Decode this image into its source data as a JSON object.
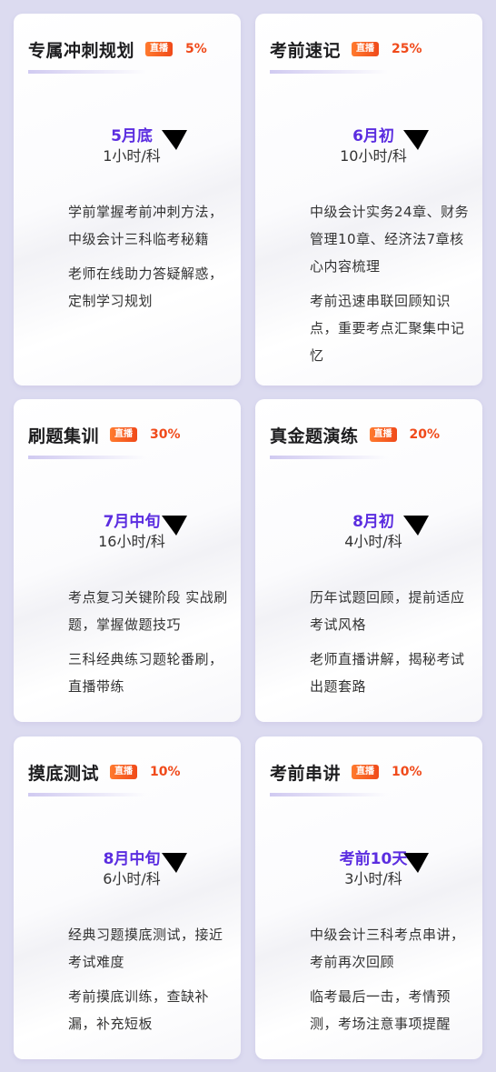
{
  "badge_label": "直播",
  "colors": {
    "accent_purple": "#5b2de0",
    "accent_orange": "#f04a1a"
  },
  "cards": [
    {
      "title": "专属冲刺规划",
      "increase": "5%",
      "date": "5月底",
      "hours": "1小时/科",
      "points": [
        "学前掌握考前冲刺方法，中级会计三科临考秘籍",
        "老师在线助力答疑解惑，定制学习规划"
      ]
    },
    {
      "title": "考前速记",
      "increase": "25%",
      "date": "6月初",
      "hours": "10小时/科",
      "points": [
        "中级会计实务24章、财务管理10章、经济法7章核心内容梳理",
        "考前迅速串联回顾知识点，重要考点汇聚集中记忆"
      ]
    },
    {
      "title": "刷题集训",
      "increase": "30%",
      "date": "7月中旬",
      "hours": "16小时/科",
      "points": [
        "考点复习关键阶段 实战刷题，掌握做题技巧",
        "三科经典练习题轮番刷，直播带练"
      ]
    },
    {
      "title": "真金题演练",
      "increase": "20%",
      "date": "8月初",
      "hours": "4小时/科",
      "points": [
        "历年试题回顾，提前适应考试风格",
        "老师直播讲解，揭秘考试出题套路"
      ]
    },
    {
      "title": "摸底测试",
      "increase": "10%",
      "date": "8月中旬",
      "hours": "6小时/科",
      "points": [
        "经典习题摸底测试，接近考试难度",
        "考前摸底训练，查缺补漏，补充短板"
      ]
    },
    {
      "title": "考前串讲",
      "increase": "10%",
      "date": "考前10天",
      "hours": "3小时/科",
      "points": [
        "中级会计三科考点串讲，考前再次回顾",
        "临考最后一击，考情预测，考场注意事项提醒"
      ]
    }
  ]
}
